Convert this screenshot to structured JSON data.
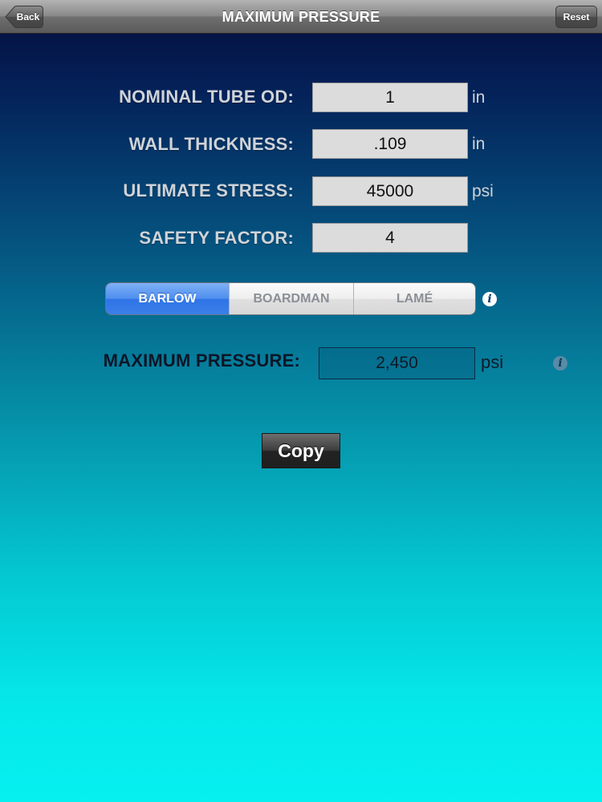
{
  "navbar": {
    "title": "MAXIMUM PRESSURE",
    "back_label": "Back",
    "reset_label": "Reset"
  },
  "form": {
    "rows": [
      {
        "label": "NOMINAL TUBE OD:",
        "value": "1",
        "unit": "in"
      },
      {
        "label": "WALL THICKNESS:",
        "value": ".109",
        "unit": "in"
      },
      {
        "label": "ULTIMATE STRESS:",
        "value": "45000",
        "unit": "psi"
      },
      {
        "label": "SAFETY FACTOR:",
        "value": "4",
        "unit": ""
      }
    ]
  },
  "formula": {
    "options": [
      "BARLOW",
      "BOARDMAN",
      "LAMÉ"
    ],
    "selected": "BARLOW",
    "info_icon": "info-icon"
  },
  "result": {
    "label": "MAXIMUM PRESSURE:",
    "value": "2,450",
    "unit": "psi",
    "info_icon": "info-icon"
  },
  "actions": {
    "copy_label": "Copy"
  },
  "colors": {
    "accent_selected": "#3a7fe9",
    "background_top": "#040c3c",
    "background_bottom": "#06f0f0"
  }
}
